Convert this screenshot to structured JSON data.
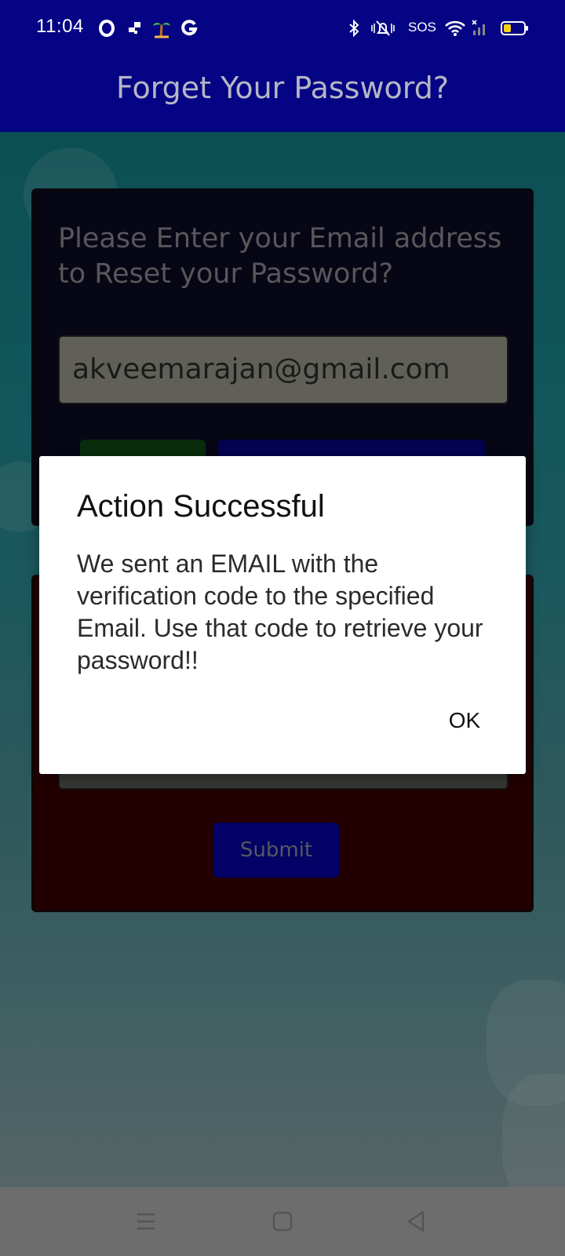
{
  "status_bar": {
    "time": "11:04",
    "sos": "SOS",
    "icons": [
      "opera-icon",
      "grid-icon",
      "palm-tree-icon",
      "google-icon",
      "bluetooth-icon",
      "vibrate-mute-icon",
      "wifi-icon",
      "signal-icon",
      "battery-icon"
    ]
  },
  "header": {
    "title": "Forget Your Password?"
  },
  "reset_card": {
    "prompt": "Please Enter your Email address to Reset your Password?",
    "email_value": "akveemarajan@gmail.com"
  },
  "verify_card": {
    "submit_label": "Submit"
  },
  "dialog": {
    "title": "Action Successful",
    "message": "We sent an EMAIL with the verification code to the specified Email. Use that code to retrieve your password!!",
    "ok_label": "OK"
  },
  "nav": {
    "icons": [
      "menu-icon",
      "home-square-icon",
      "back-triangle-icon"
    ]
  },
  "colors": {
    "header_bg": "#040484",
    "card_dark": "#0a0a22",
    "card_red": "#370002",
    "button_blue": "#0404a6",
    "button_green": "#0f4a12"
  }
}
